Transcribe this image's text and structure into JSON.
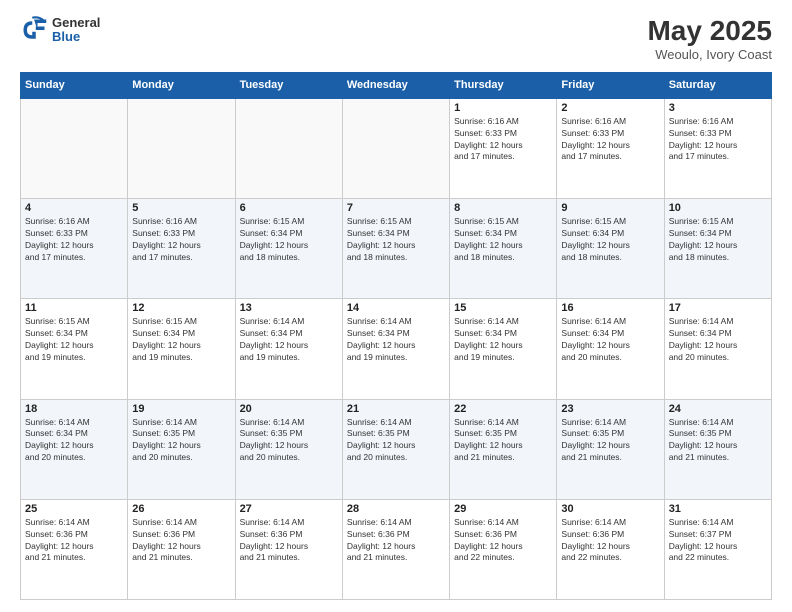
{
  "header": {
    "logo_general": "General",
    "logo_blue": "Blue",
    "month_title": "May 2025",
    "location": "Weoulo, Ivory Coast"
  },
  "weekdays": [
    "Sunday",
    "Monday",
    "Tuesday",
    "Wednesday",
    "Thursday",
    "Friday",
    "Saturday"
  ],
  "weeks": [
    [
      {
        "day": "",
        "info": ""
      },
      {
        "day": "",
        "info": ""
      },
      {
        "day": "",
        "info": ""
      },
      {
        "day": "",
        "info": ""
      },
      {
        "day": "1",
        "info": "Sunrise: 6:16 AM\nSunset: 6:33 PM\nDaylight: 12 hours\nand 17 minutes."
      },
      {
        "day": "2",
        "info": "Sunrise: 6:16 AM\nSunset: 6:33 PM\nDaylight: 12 hours\nand 17 minutes."
      },
      {
        "day": "3",
        "info": "Sunrise: 6:16 AM\nSunset: 6:33 PM\nDaylight: 12 hours\nand 17 minutes."
      }
    ],
    [
      {
        "day": "4",
        "info": "Sunrise: 6:16 AM\nSunset: 6:33 PM\nDaylight: 12 hours\nand 17 minutes."
      },
      {
        "day": "5",
        "info": "Sunrise: 6:16 AM\nSunset: 6:33 PM\nDaylight: 12 hours\nand 17 minutes."
      },
      {
        "day": "6",
        "info": "Sunrise: 6:15 AM\nSunset: 6:34 PM\nDaylight: 12 hours\nand 18 minutes."
      },
      {
        "day": "7",
        "info": "Sunrise: 6:15 AM\nSunset: 6:34 PM\nDaylight: 12 hours\nand 18 minutes."
      },
      {
        "day": "8",
        "info": "Sunrise: 6:15 AM\nSunset: 6:34 PM\nDaylight: 12 hours\nand 18 minutes."
      },
      {
        "day": "9",
        "info": "Sunrise: 6:15 AM\nSunset: 6:34 PM\nDaylight: 12 hours\nand 18 minutes."
      },
      {
        "day": "10",
        "info": "Sunrise: 6:15 AM\nSunset: 6:34 PM\nDaylight: 12 hours\nand 18 minutes."
      }
    ],
    [
      {
        "day": "11",
        "info": "Sunrise: 6:15 AM\nSunset: 6:34 PM\nDaylight: 12 hours\nand 19 minutes."
      },
      {
        "day": "12",
        "info": "Sunrise: 6:15 AM\nSunset: 6:34 PM\nDaylight: 12 hours\nand 19 minutes."
      },
      {
        "day": "13",
        "info": "Sunrise: 6:14 AM\nSunset: 6:34 PM\nDaylight: 12 hours\nand 19 minutes."
      },
      {
        "day": "14",
        "info": "Sunrise: 6:14 AM\nSunset: 6:34 PM\nDaylight: 12 hours\nand 19 minutes."
      },
      {
        "day": "15",
        "info": "Sunrise: 6:14 AM\nSunset: 6:34 PM\nDaylight: 12 hours\nand 19 minutes."
      },
      {
        "day": "16",
        "info": "Sunrise: 6:14 AM\nSunset: 6:34 PM\nDaylight: 12 hours\nand 20 minutes."
      },
      {
        "day": "17",
        "info": "Sunrise: 6:14 AM\nSunset: 6:34 PM\nDaylight: 12 hours\nand 20 minutes."
      }
    ],
    [
      {
        "day": "18",
        "info": "Sunrise: 6:14 AM\nSunset: 6:34 PM\nDaylight: 12 hours\nand 20 minutes."
      },
      {
        "day": "19",
        "info": "Sunrise: 6:14 AM\nSunset: 6:35 PM\nDaylight: 12 hours\nand 20 minutes."
      },
      {
        "day": "20",
        "info": "Sunrise: 6:14 AM\nSunset: 6:35 PM\nDaylight: 12 hours\nand 20 minutes."
      },
      {
        "day": "21",
        "info": "Sunrise: 6:14 AM\nSunset: 6:35 PM\nDaylight: 12 hours\nand 20 minutes."
      },
      {
        "day": "22",
        "info": "Sunrise: 6:14 AM\nSunset: 6:35 PM\nDaylight: 12 hours\nand 21 minutes."
      },
      {
        "day": "23",
        "info": "Sunrise: 6:14 AM\nSunset: 6:35 PM\nDaylight: 12 hours\nand 21 minutes."
      },
      {
        "day": "24",
        "info": "Sunrise: 6:14 AM\nSunset: 6:35 PM\nDaylight: 12 hours\nand 21 minutes."
      }
    ],
    [
      {
        "day": "25",
        "info": "Sunrise: 6:14 AM\nSunset: 6:36 PM\nDaylight: 12 hours\nand 21 minutes."
      },
      {
        "day": "26",
        "info": "Sunrise: 6:14 AM\nSunset: 6:36 PM\nDaylight: 12 hours\nand 21 minutes."
      },
      {
        "day": "27",
        "info": "Sunrise: 6:14 AM\nSunset: 6:36 PM\nDaylight: 12 hours\nand 21 minutes."
      },
      {
        "day": "28",
        "info": "Sunrise: 6:14 AM\nSunset: 6:36 PM\nDaylight: 12 hours\nand 21 minutes."
      },
      {
        "day": "29",
        "info": "Sunrise: 6:14 AM\nSunset: 6:36 PM\nDaylight: 12 hours\nand 22 minutes."
      },
      {
        "day": "30",
        "info": "Sunrise: 6:14 AM\nSunset: 6:36 PM\nDaylight: 12 hours\nand 22 minutes."
      },
      {
        "day": "31",
        "info": "Sunrise: 6:14 AM\nSunset: 6:37 PM\nDaylight: 12 hours\nand 22 minutes."
      }
    ]
  ]
}
